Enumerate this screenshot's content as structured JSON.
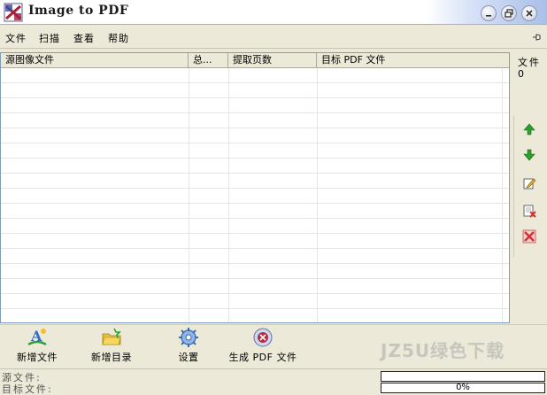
{
  "window": {
    "title": "Image to PDF"
  },
  "menu": {
    "items": [
      "文件",
      "扫描",
      "查看",
      "帮助"
    ]
  },
  "table": {
    "columns": [
      "源图像文件",
      "总...",
      "提取页数",
      "目标 PDF 文件"
    ],
    "rows": []
  },
  "side_panel": {
    "count_label": "文件",
    "count_value": "0"
  },
  "toolbar": {
    "add_files": "新增文件",
    "add_folder": "新增目录",
    "settings": "设置",
    "generate_pdf": "生成 PDF 文件"
  },
  "status": {
    "source_label": "源文件:",
    "target_label": "目标文件:",
    "source_progress": 0,
    "target_progress": 0,
    "target_progress_text": "0%"
  },
  "watermark": "JZ5U绿色下载",
  "colors": {
    "accent_green": "#2e9e2e",
    "accent_red": "#d83030",
    "title_blue": "#a9bfe8"
  }
}
